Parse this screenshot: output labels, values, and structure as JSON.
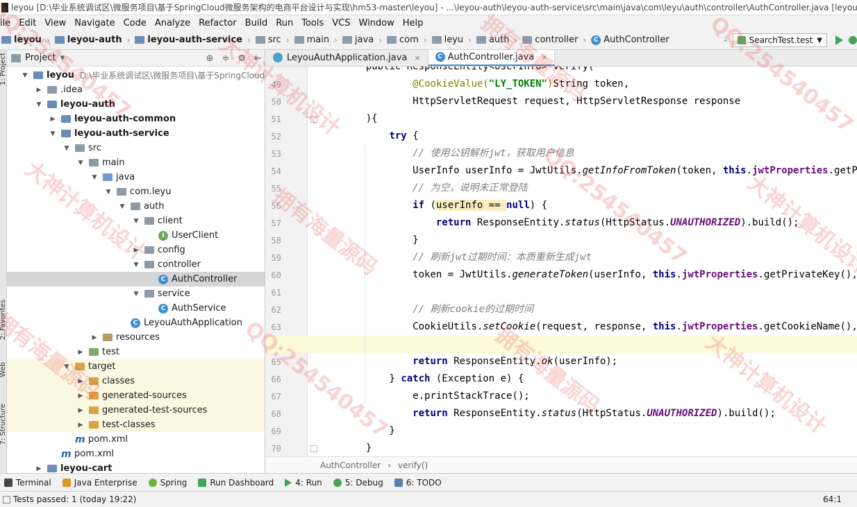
{
  "window": {
    "title": "leyou [D:\\毕业系统调试区\\微服务项目\\基于SpringCloud微服务架构的电商平台设计与实现\\hm53-master\\leyou] - ...\\leyou-auth\\leyou-auth-service\\src\\main\\java\\com\\leyu\\auth\\controller\\AuthController.java [leyou..."
  },
  "menu": {
    "items": [
      "ile",
      "Edit",
      "View",
      "Navigate",
      "Code",
      "Analyze",
      "Refactor",
      "Build",
      "Run",
      "Tools",
      "VCS",
      "Window",
      "Help"
    ]
  },
  "navbar": {
    "crumbs": [
      {
        "label": "leyou",
        "icon": "folder-icon",
        "bold": true
      },
      {
        "label": "leyou-auth",
        "icon": "folder-icon",
        "bold": true
      },
      {
        "label": "leyou-auth-service",
        "icon": "folder-icon",
        "bold": true
      },
      {
        "label": "src",
        "icon": "folder-icon",
        "bold": false
      },
      {
        "label": "main",
        "icon": "folder-icon",
        "bold": false
      },
      {
        "label": "java",
        "icon": "folder-icon",
        "bold": false
      },
      {
        "label": "com",
        "icon": "folder-icon",
        "bold": false
      },
      {
        "label": "leyu",
        "icon": "folder-icon",
        "bold": false
      },
      {
        "label": "auth",
        "icon": "folder-icon",
        "bold": false
      },
      {
        "label": "controller",
        "icon": "folder-icon",
        "bold": false
      },
      {
        "label": "AuthController",
        "icon": "class-icon",
        "bold": false
      }
    ],
    "run_config": "SearchTest.test"
  },
  "left_strip": {
    "tabs": [
      "1: Project",
      "2: Favorites",
      "Web",
      "7: Structure"
    ]
  },
  "project_panel": {
    "title": "Project",
    "tree": [
      {
        "depth": 0,
        "expand": "down",
        "icon": "mod",
        "label": "leyou",
        "bold": true,
        "path": "D:\\毕业系统调试区\\微服务项目\\基于SpringCloud微服"
      },
      {
        "depth": 1,
        "expand": "right",
        "icon": "folder",
        "label": ".idea",
        "bold": false,
        "path": ""
      },
      {
        "depth": 1,
        "expand": "down",
        "icon": "mod",
        "label": "leyou-auth",
        "bold": true,
        "path": ""
      },
      {
        "depth": 2,
        "expand": "right",
        "icon": "mod",
        "label": "leyou-auth-common",
        "bold": true,
        "path": ""
      },
      {
        "depth": 2,
        "expand": "down",
        "icon": "mod",
        "label": "leyou-auth-service",
        "bold": true,
        "path": ""
      },
      {
        "depth": 3,
        "expand": "down",
        "icon": "folder",
        "label": "src",
        "bold": false,
        "path": ""
      },
      {
        "depth": 4,
        "expand": "down",
        "icon": "folder",
        "label": "main",
        "bold": false,
        "path": ""
      },
      {
        "depth": 5,
        "expand": "down",
        "icon": "src",
        "label": "java",
        "bold": false,
        "path": ""
      },
      {
        "depth": 6,
        "expand": "down",
        "icon": "folder",
        "label": "com.leyu",
        "bold": false,
        "path": ""
      },
      {
        "depth": 7,
        "expand": "down",
        "icon": "folder",
        "label": "auth",
        "bold": false,
        "path": ""
      },
      {
        "depth": 8,
        "expand": "down",
        "icon": "folder",
        "label": "client",
        "bold": false,
        "path": ""
      },
      {
        "depth": 9,
        "expand": "none",
        "icon": "intf",
        "label": "UserClient",
        "bold": false,
        "path": ""
      },
      {
        "depth": 8,
        "expand": "right",
        "icon": "folder",
        "label": "config",
        "bold": false,
        "path": ""
      },
      {
        "depth": 8,
        "expand": "down",
        "icon": "folder",
        "label": "controller",
        "bold": false,
        "path": ""
      },
      {
        "depth": 9,
        "expand": "none",
        "icon": "cls",
        "label": "AuthController",
        "bold": false,
        "path": "",
        "selected": true
      },
      {
        "depth": 8,
        "expand": "down",
        "icon": "folder",
        "label": "service",
        "bold": false,
        "path": ""
      },
      {
        "depth": 9,
        "expand": "none",
        "icon": "cls",
        "label": "AuthService",
        "bold": false,
        "path": ""
      },
      {
        "depth": 7,
        "expand": "none",
        "icon": "cls",
        "label": "LeyouAuthApplication",
        "bold": false,
        "path": ""
      },
      {
        "depth": 5,
        "expand": "right",
        "icon": "res",
        "label": "resources",
        "bold": false,
        "path": ""
      },
      {
        "depth": 4,
        "expand": "right",
        "icon": "test",
        "label": "test",
        "bold": false,
        "path": ""
      },
      {
        "depth": 3,
        "expand": "down",
        "icon": "target",
        "label": "target",
        "bold": false,
        "path": "",
        "target": true
      },
      {
        "depth": 4,
        "expand": "right",
        "icon": "target",
        "label": "classes",
        "bold": false,
        "path": "",
        "target": true
      },
      {
        "depth": 4,
        "expand": "right",
        "icon": "target",
        "label": "generated-sources",
        "bold": false,
        "path": "",
        "target": true
      },
      {
        "depth": 4,
        "expand": "right",
        "icon": "target",
        "label": "generated-test-sources",
        "bold": false,
        "path": "",
        "target": true
      },
      {
        "depth": 4,
        "expand": "right",
        "icon": "target",
        "label": "test-classes",
        "bold": false,
        "path": "",
        "target": true
      },
      {
        "depth": 3,
        "expand": "none",
        "icon": "pom",
        "label": "pom.xml",
        "bold": false,
        "path": ""
      },
      {
        "depth": 2,
        "expand": "none",
        "icon": "pom",
        "label": "pom.xml",
        "bold": false,
        "path": ""
      },
      {
        "depth": 1,
        "expand": "right",
        "icon": "mod",
        "label": "leyou-cart",
        "bold": true,
        "path": ""
      }
    ]
  },
  "editor": {
    "tabs": [
      {
        "label": "LeyouAuthApplication.java",
        "active": false
      },
      {
        "label": "AuthController.java",
        "active": true
      }
    ],
    "lines": [
      {
        "no": "",
        "indent": 0,
        "segs": [
          [
            "",
            "    public ResponseEntity<UserInfo> verify("
          ]
        ]
      },
      {
        "no": "49",
        "indent": 0,
        "segs": [
          [
            "",
            "            "
          ],
          [
            "ann",
            "@CookieValue("
          ],
          [
            "str",
            "\"LY_TOKEN\""
          ],
          [
            "ann",
            ")"
          ],
          [
            "",
            "String token,"
          ]
        ]
      },
      {
        "no": "50",
        "indent": 0,
        "segs": [
          [
            "",
            "            HttpServletRequest request, HttpServletResponse response"
          ]
        ]
      },
      {
        "no": "51",
        "indent": 0,
        "segs": [
          [
            "",
            "    ){"
          ]
        ]
      },
      {
        "no": "52",
        "indent": 0,
        "segs": [
          [
            "",
            "        "
          ],
          [
            "kw",
            "try"
          ],
          [
            "",
            " {"
          ]
        ]
      },
      {
        "no": "53",
        "indent": 0,
        "segs": [
          [
            "",
            "            "
          ],
          [
            "cmt",
            "// 使用公钥解析jwt，获取用户信息"
          ]
        ]
      },
      {
        "no": "54",
        "indent": 0,
        "segs": [
          [
            "",
            "            UserInfo userInfo = JwtUtils."
          ],
          [
            "mth",
            "getInfoFromToken"
          ],
          [
            "",
            "(token, "
          ],
          [
            "kw",
            "this"
          ],
          [
            "",
            "."
          ],
          [
            "fld",
            "jwtProperties"
          ],
          [
            "",
            ".getPublicKey());"
          ]
        ]
      },
      {
        "no": "55",
        "indent": 0,
        "segs": [
          [
            "",
            "            "
          ],
          [
            "cmt",
            "// 为空，说明未正常登陆"
          ]
        ]
      },
      {
        "no": "56",
        "indent": 0,
        "segs": [
          [
            "",
            "            "
          ],
          [
            "kw",
            "if"
          ],
          [
            "",
            " ("
          ],
          [
            "hl",
            "userInfo == "
          ],
          [
            "kw",
            "null"
          ],
          [
            "",
            ") {"
          ]
        ]
      },
      {
        "no": "57",
        "indent": 0,
        "segs": [
          [
            "",
            "                "
          ],
          [
            "kw",
            "return"
          ],
          [
            "",
            " ResponseEntity."
          ],
          [
            "mth",
            "status"
          ],
          [
            "",
            "(HttpStatus."
          ],
          [
            "cst",
            "UNAUTHORIZED"
          ],
          [
            "",
            ").build();"
          ]
        ]
      },
      {
        "no": "58",
        "indent": 0,
        "segs": [
          [
            "",
            "            }"
          ]
        ]
      },
      {
        "no": "59",
        "indent": 0,
        "segs": [
          [
            "",
            "            "
          ],
          [
            "cmt",
            "// 刷新jwt过期时间：本质重新生成jwt"
          ]
        ]
      },
      {
        "no": "60",
        "indent": 0,
        "segs": [
          [
            "",
            "            token = JwtUtils."
          ],
          [
            "mth",
            "generateToken"
          ],
          [
            "",
            "(userInfo, "
          ],
          [
            "kw",
            "this"
          ],
          [
            "",
            "."
          ],
          [
            "fld",
            "jwtProperties"
          ],
          [
            "",
            ".getPrivateKey(), "
          ],
          [
            "kw",
            "this"
          ],
          [
            "",
            "."
          ]
        ]
      },
      {
        "no": "61",
        "indent": 0,
        "segs": [
          [
            "",
            ""
          ]
        ]
      },
      {
        "no": "62",
        "indent": 0,
        "segs": [
          [
            "",
            "            "
          ],
          [
            "cmt",
            "// 刷新cookie的过期时间"
          ]
        ]
      },
      {
        "no": "63",
        "indent": 0,
        "segs": [
          [
            "",
            "            CookieUtils."
          ],
          [
            "mth",
            "setCookie"
          ],
          [
            "",
            "(request, response, "
          ],
          [
            "kw",
            "this"
          ],
          [
            "",
            "."
          ],
          [
            "fld",
            "jwtProperties"
          ],
          [
            "",
            ".getCookieName(), token,"
          ]
        ]
      },
      {
        "no": "64",
        "indent": 0,
        "segs": [
          [
            "",
            ""
          ]
        ],
        "caret": true
      },
      {
        "no": "65",
        "indent": 0,
        "segs": [
          [
            "",
            "            "
          ],
          [
            "kw",
            "return"
          ],
          [
            "",
            " ResponseEntity."
          ],
          [
            "mth",
            "ok"
          ],
          [
            "",
            "(userInfo);"
          ]
        ]
      },
      {
        "no": "66",
        "indent": 0,
        "segs": [
          [
            "",
            "        } "
          ],
          [
            "kw",
            "catch"
          ],
          [
            "",
            " (Exception e) {"
          ]
        ]
      },
      {
        "no": "67",
        "indent": 0,
        "segs": [
          [
            "",
            "            e.printStackTrace();"
          ]
        ]
      },
      {
        "no": "68",
        "indent": 0,
        "segs": [
          [
            "",
            "            "
          ],
          [
            "kw",
            "return"
          ],
          [
            "",
            " ResponseEntity."
          ],
          [
            "mth",
            "status"
          ],
          [
            "",
            "(HttpStatus."
          ],
          [
            "cst",
            "UNAUTHORIZED"
          ],
          [
            "",
            ").build();"
          ]
        ]
      },
      {
        "no": "69",
        "indent": 0,
        "segs": [
          [
            "",
            "        }"
          ]
        ]
      },
      {
        "no": "70",
        "indent": 0,
        "segs": [
          [
            "",
            "    }"
          ]
        ]
      }
    ],
    "breadcrumb": [
      "AuthController",
      "verify()"
    ]
  },
  "tool_windows": [
    {
      "label": "Terminal",
      "icon": "term"
    },
    {
      "label": "Java Enterprise",
      "icon": "je"
    },
    {
      "label": "Spring",
      "icon": "spring"
    },
    {
      "label": "Run Dashboard",
      "icon": "rd"
    },
    {
      "label": "4: Run",
      "icon": "run"
    },
    {
      "label": "5: Debug",
      "icon": "debug"
    },
    {
      "label": "6: TODO",
      "icon": "todo"
    }
  ],
  "status": {
    "message": "Tests passed: 1 (today 19:22)",
    "position": "64:1"
  },
  "watermarks": [
    "QQ:254540457",
    "大神计算机设计",
    "拥有海量源码",
    "QQ:254540457",
    "大神计算机设计",
    "拥有海量源码",
    "QQ:254540457",
    "大神计算机设计",
    "拥有海量源码",
    "QQ:254540457",
    "拥有海量源码",
    "大神计算机设计"
  ]
}
